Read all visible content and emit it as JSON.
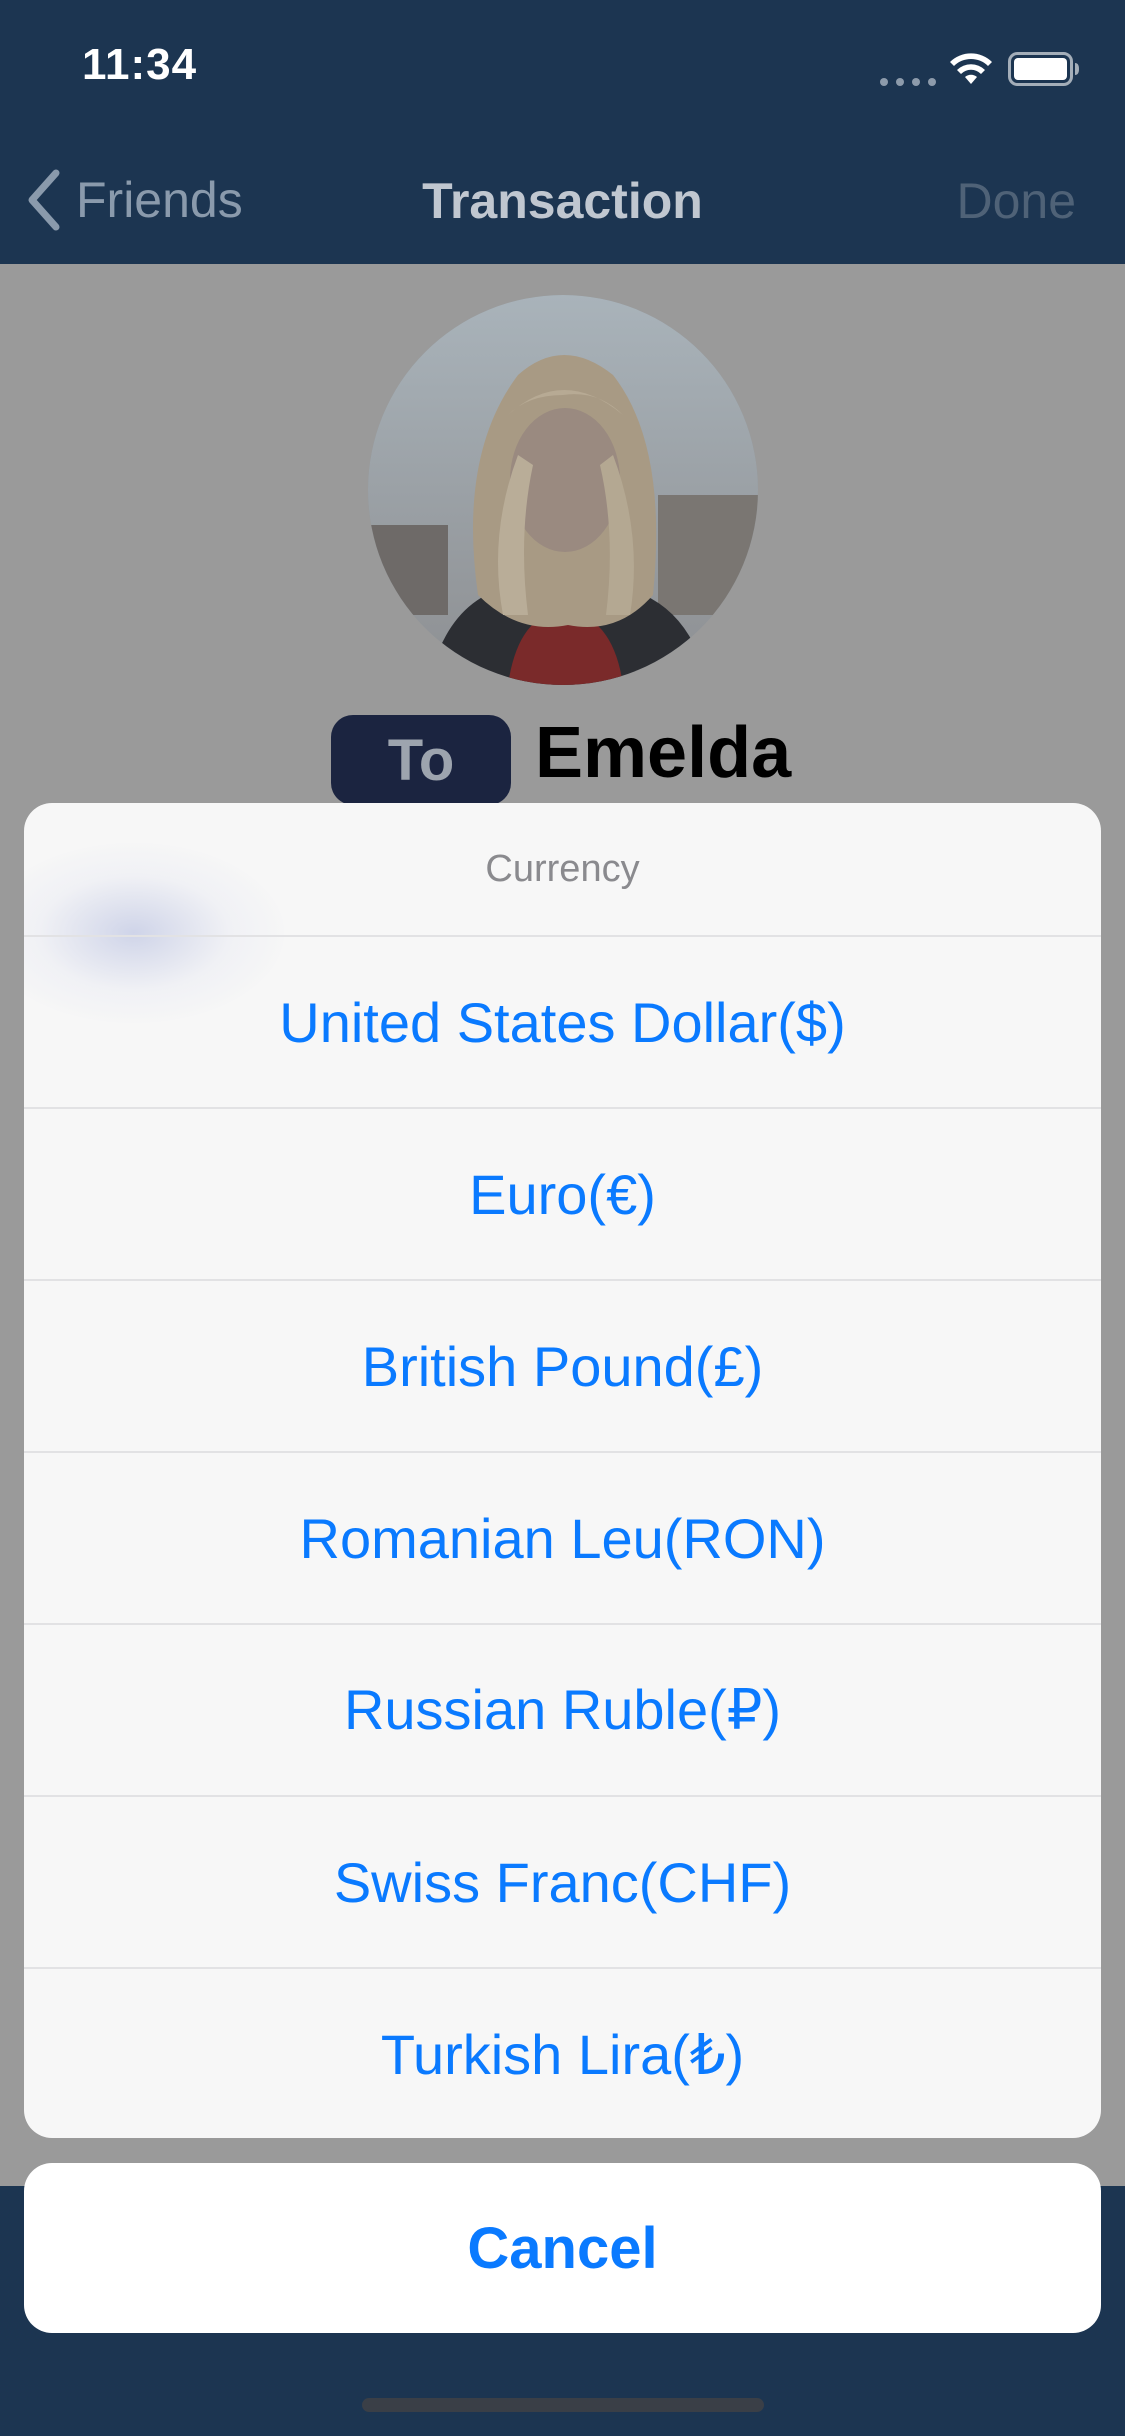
{
  "status_bar": {
    "time": "11:34"
  },
  "nav": {
    "back_label": "Friends",
    "title": "Transaction",
    "done_label": "Done"
  },
  "recipient": {
    "direction_label": "To",
    "name": "Emelda"
  },
  "action_sheet": {
    "title": "Currency",
    "options": [
      {
        "label": "United States Dollar($)"
      },
      {
        "label": "Euro(€)"
      },
      {
        "label": "British Pound(£)"
      },
      {
        "label": "Romanian Leu(RON)"
      },
      {
        "label": "Russian Ruble(₽)"
      },
      {
        "label": "Swiss Franc(CHF)"
      },
      {
        "label": "Turkish Lira(₺)"
      }
    ],
    "cancel_label": "Cancel"
  },
  "colors": {
    "nav_background": "#1c3551",
    "accent": "#0a7aff",
    "dim_overlay": "#9a9a9a",
    "chip_background": "#1b2440"
  },
  "icons": [
    "chevron-left-icon",
    "wifi-icon",
    "battery-icon",
    "signal-icon"
  ]
}
